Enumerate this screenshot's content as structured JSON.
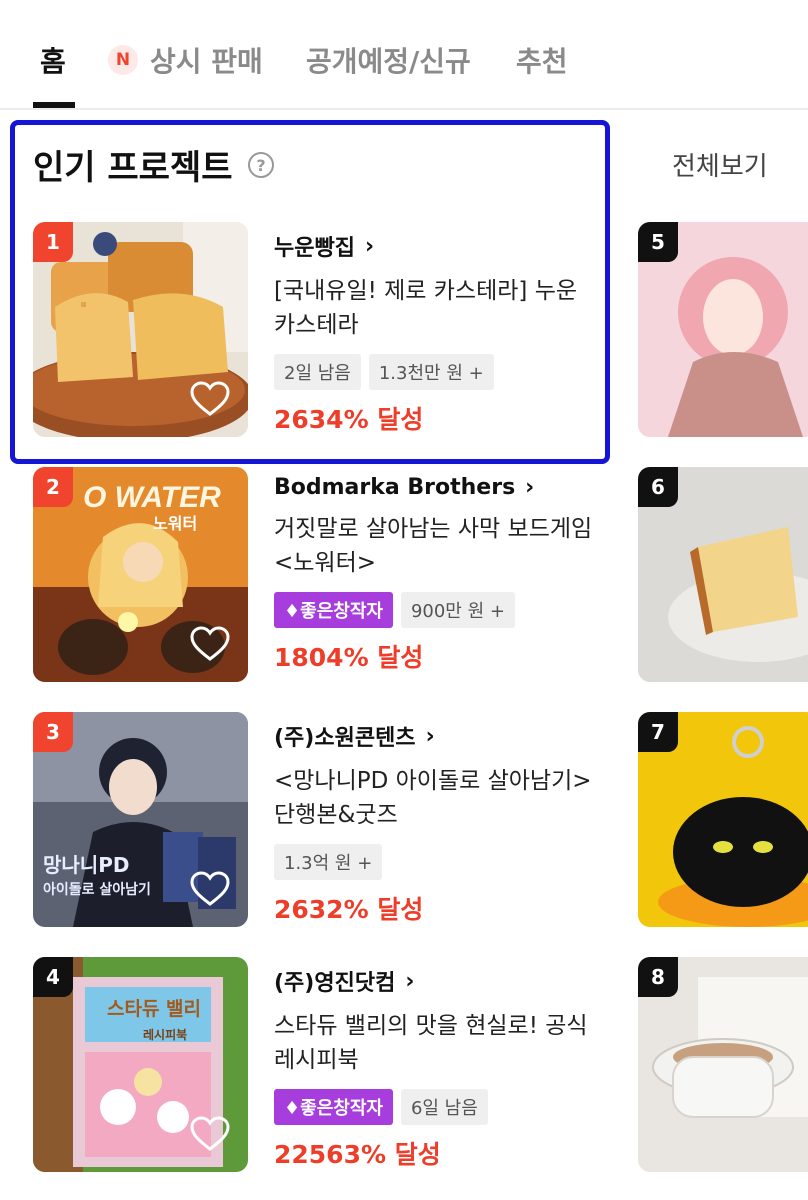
{
  "tabs": [
    {
      "label": "홈",
      "active": true
    },
    {
      "label": "상시 판매",
      "badge": "N"
    },
    {
      "label": "공개예정/신규"
    },
    {
      "label": "추천"
    }
  ],
  "section": {
    "title": "인기 프로젝트",
    "help_icon": "question-circle-icon",
    "view_all": "전체보기"
  },
  "projects": [
    {
      "rank": "1",
      "creator": "누운빵집",
      "title": "[국내유일! 제로 카스테라] 누운 카스테라",
      "tags": [
        "2일 남음",
        "1.3천만 원 +"
      ],
      "achievement": "2634% 달성"
    },
    {
      "rank": "2",
      "creator": "Bodmarka Brothers",
      "title": "거짓말로 살아남는 사막 보드게임 <노워터>",
      "creator_badge": "♦좋은창작자",
      "tags": [
        "900만 원 +"
      ],
      "achievement": "1804% 달성",
      "thumb_text": "O WATER",
      "thumb_subtext": "노워터"
    },
    {
      "rank": "3",
      "creator": "(주)소원콘텐츠",
      "title": "<망나니PD 아이돌로 살아남기>단행본&굿즈",
      "tags": [
        "1.3억 원 +"
      ],
      "achievement": "2632% 달성",
      "thumb_text": "망나니PD",
      "thumb_subtext": "아이돌로 살아남기"
    },
    {
      "rank": "4",
      "creator": "(주)영진닷컴",
      "title": "스타듀 밸리의 맛을 현실로! 공식 레시피북",
      "creator_badge": "♦좋은창작자",
      "tags": [
        "6일 남음"
      ],
      "achievement": "22563% 달성",
      "thumb_text": "스타듀 밸리",
      "thumb_subtext": "레시피북"
    }
  ],
  "side_projects": [
    {
      "rank": "5"
    },
    {
      "rank": "6"
    },
    {
      "rank": "7"
    },
    {
      "rank": "8"
    }
  ],
  "colors": {
    "accent_red": "#f0442f",
    "achievement_red": "#ee3d29",
    "creator_badge_purple": "#a63ddc",
    "highlight_blue": "#1515d6"
  }
}
